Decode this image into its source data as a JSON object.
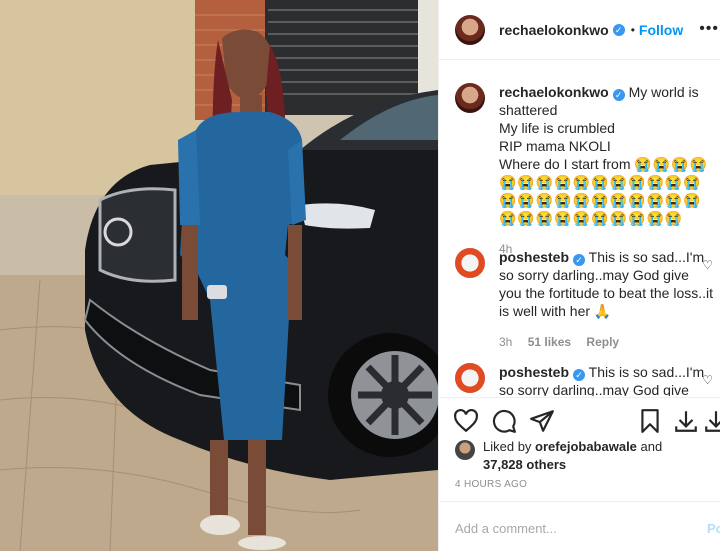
{
  "header": {
    "username": "rechaelokonkwo",
    "separator": "•",
    "follow_label": "Follow",
    "more_label": "•••"
  },
  "caption": {
    "username": "rechaelokonkwo",
    "line1": "My world is shattered",
    "line2": "My life is crumbled",
    "line3": "RIP mama NKOLI",
    "line4": "Where do I start from",
    "emoji": "😭😭😭😭😭😭😭😭😭😭😭😭😭😭😭😭😭😭😭😭😭😭😭😭😭😭😭😭😭😭😭😭😭😭😭😭",
    "time": "4h"
  },
  "comments": [
    {
      "username": "poshesteb",
      "text": "This is so sad...I'm so sorry darling..may God give you the fortitude to beat the loss..it is well with her 🙏",
      "time": "3h",
      "likes": "51 likes",
      "reply": "Reply"
    },
    {
      "username": "poshesteb",
      "text": "This is so sad...I'm so sorry darling..may God give you"
    }
  ],
  "actions": {
    "like_icon": "heart-outline-icon",
    "comment_icon": "comment-icon",
    "share_icon": "paper-plane-icon",
    "save_icon": "bookmark-icon",
    "download_icon": "download-icon"
  },
  "likes": {
    "prefix": "Liked by",
    "user": "orefejobabawale",
    "and": "and",
    "count": "37,828 others"
  },
  "posted": "4 HOURS AGO",
  "add_comment": {
    "placeholder": "Add a comment...",
    "post_label": "Po"
  },
  "colors": {
    "accent": "#0095f6",
    "verified": "#3897f0",
    "muted": "#8e8e8e",
    "border": "#efefef"
  }
}
